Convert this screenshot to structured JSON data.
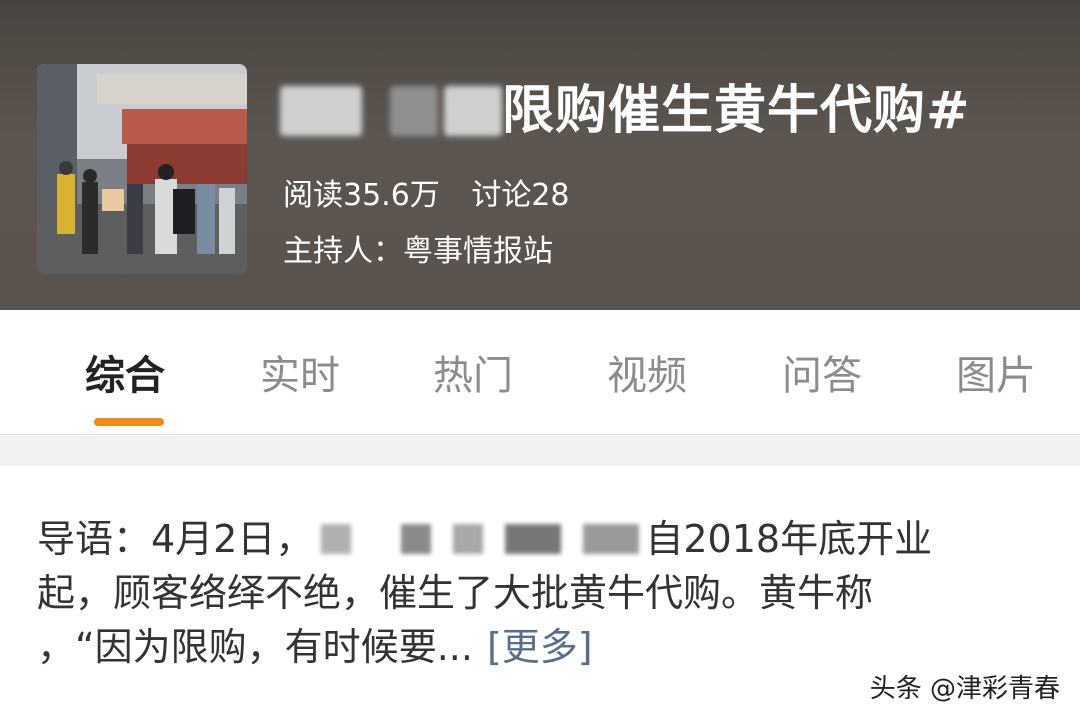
{
  "topic": {
    "title_visible": "限购催生黄牛代购#",
    "stats": {
      "read": "阅读35.6万",
      "discuss": "讨论28"
    },
    "host": "主持人：粤事情报站"
  },
  "tabs": [
    {
      "label": "综合",
      "active": true
    },
    {
      "label": "实时",
      "active": false
    },
    {
      "label": "热门",
      "active": false
    },
    {
      "label": "视频",
      "active": false
    },
    {
      "label": "问答",
      "active": false
    },
    {
      "label": "图片",
      "active": false
    }
  ],
  "intro": {
    "line1_start": "导语：4月2日，",
    "line1_end": "自2018年底开业",
    "line2": "起，顾客络绎不绝，催生了大批黄牛代购。黄牛称",
    "line3": "，“因为限购，有时候要...",
    "more_label": "[更多]"
  },
  "watermark": "头条 @津彩青春",
  "colors": {
    "accent": "#f08c1c",
    "more_link": "#5a6e8c"
  }
}
